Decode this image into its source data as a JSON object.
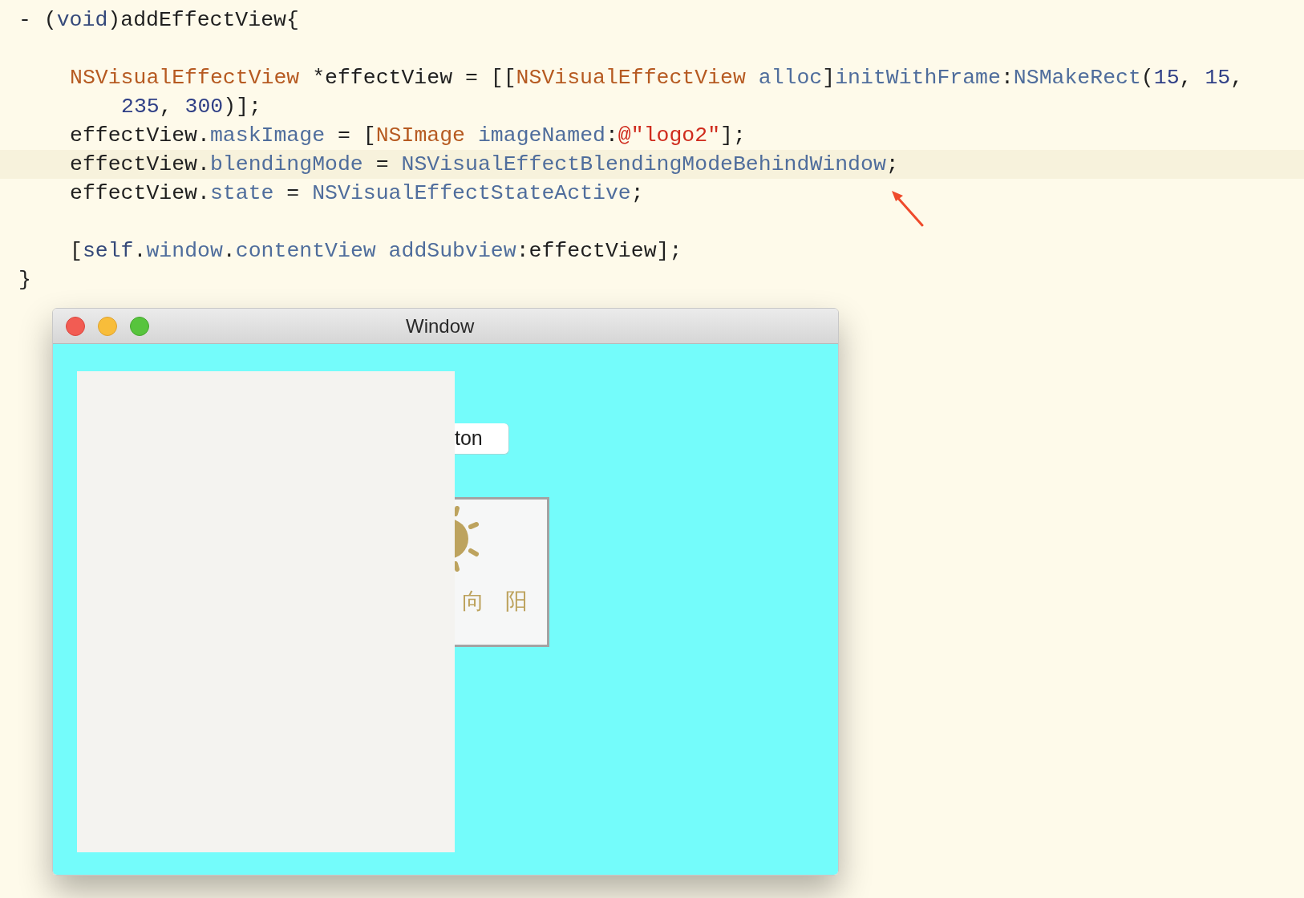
{
  "code": {
    "lines": [
      {
        "kind": "top",
        "highlighted": false,
        "tokens": [
          {
            "kind": "plain",
            "text": "- ("
          },
          {
            "kind": "keyword",
            "text": "void"
          },
          {
            "kind": "plain",
            "text": ")addEffectView{"
          }
        ]
      },
      {
        "kind": "blank"
      },
      {
        "kind": "statement",
        "highlighted": false,
        "tokens": [
          {
            "kind": "class",
            "text": "NSVisualEffectView"
          },
          {
            "kind": "plain",
            "text": " *effectView = [["
          },
          {
            "kind": "class",
            "text": "NSVisualEffectView"
          },
          {
            "kind": "method",
            "text": " alloc"
          },
          {
            "kind": "plain",
            "text": "]"
          },
          {
            "kind": "method",
            "text": "initWithFrame"
          },
          {
            "kind": "plain",
            "text": ":"
          },
          {
            "kind": "method",
            "text": "NSMakeRect"
          },
          {
            "kind": "plain",
            "text": "("
          },
          {
            "kind": "number",
            "text": "15"
          },
          {
            "kind": "plain",
            "text": ", "
          },
          {
            "kind": "number",
            "text": "15"
          },
          {
            "kind": "plain",
            "text": ","
          }
        ]
      },
      {
        "kind": "continuation",
        "highlighted": false,
        "tokens": [
          {
            "kind": "number",
            "text": "235"
          },
          {
            "kind": "plain",
            "text": ", "
          },
          {
            "kind": "number",
            "text": "300"
          },
          {
            "kind": "plain",
            "text": ")];"
          }
        ]
      },
      {
        "kind": "statement",
        "highlighted": false,
        "tokens": [
          {
            "kind": "plain",
            "text": "effectView."
          },
          {
            "kind": "method",
            "text": "maskImage"
          },
          {
            "kind": "plain",
            "text": " = ["
          },
          {
            "kind": "class",
            "text": "NSImage"
          },
          {
            "kind": "method",
            "text": " imageNamed"
          },
          {
            "kind": "plain",
            "text": ":"
          },
          {
            "kind": "string",
            "text": "@\"logo2\""
          },
          {
            "kind": "plain",
            "text": "];"
          }
        ]
      },
      {
        "kind": "statement",
        "highlighted": true,
        "tokens": [
          {
            "kind": "plain",
            "text": "effectView."
          },
          {
            "kind": "method",
            "text": "blendingMode"
          },
          {
            "kind": "plain",
            "text": " = "
          },
          {
            "kind": "method",
            "text": "NSVisualEffectBlendingModeBehindWindow"
          },
          {
            "kind": "plain",
            "text": ";"
          }
        ]
      },
      {
        "kind": "statement",
        "highlighted": false,
        "tokens": [
          {
            "kind": "plain",
            "text": "effectView."
          },
          {
            "kind": "method",
            "text": "state"
          },
          {
            "kind": "plain",
            "text": " = "
          },
          {
            "kind": "method",
            "text": "NSVisualEffectStateActive"
          },
          {
            "kind": "plain",
            "text": ";"
          }
        ]
      },
      {
        "kind": "blank"
      },
      {
        "kind": "statement",
        "highlighted": false,
        "tokens": [
          {
            "kind": "plain",
            "text": "["
          },
          {
            "kind": "keyword",
            "text": "self"
          },
          {
            "kind": "plain",
            "text": "."
          },
          {
            "kind": "method",
            "text": "window"
          },
          {
            "kind": "plain",
            "text": "."
          },
          {
            "kind": "method",
            "text": "contentView"
          },
          {
            "kind": "method",
            "text": " addSubview"
          },
          {
            "kind": "plain",
            "text": ":effectView];"
          }
        ]
      },
      {
        "kind": "top",
        "highlighted": false,
        "tokens": [
          {
            "kind": "plain",
            "text": "}"
          }
        ]
      }
    ]
  },
  "window": {
    "title": "Window",
    "button_label": "ton",
    "logo_text": [
      "向",
      "阳"
    ]
  }
}
